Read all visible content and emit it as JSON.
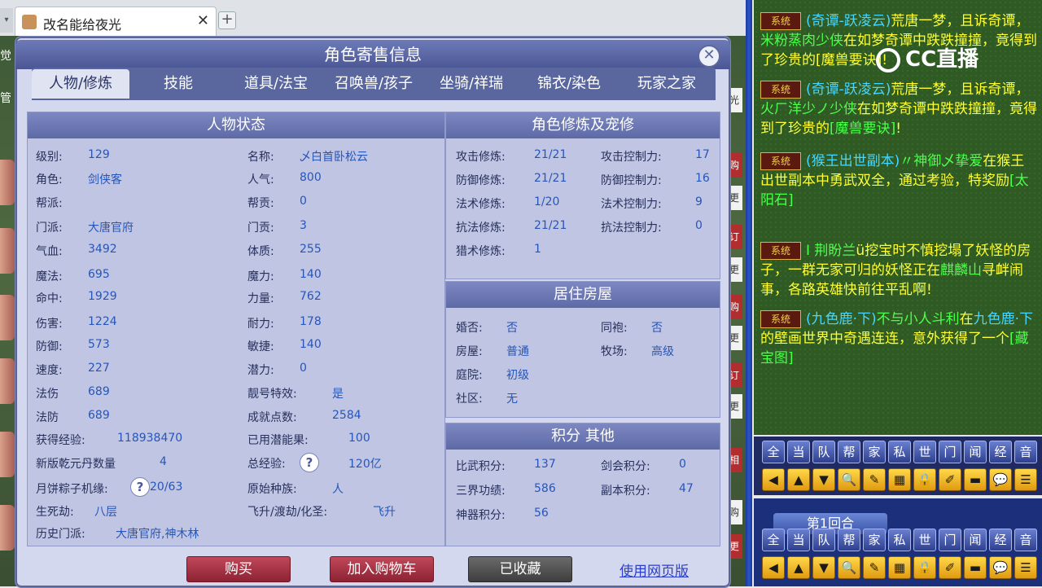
{
  "browser": {
    "tab_title": "改名能给夜光",
    "close_glyph": "✕",
    "add_glyph": "+",
    "scroll_glyph": "▾"
  },
  "left_edge_text": [
    "觉",
    "管"
  ],
  "right_strip_labels": [
    "购",
    "更",
    "订",
    "更",
    "购",
    "更",
    "订",
    "更",
    "相",
    "购",
    "更",
    "光"
  ],
  "dialog": {
    "title": "角色寄售信息",
    "close_glyph": "✕",
    "tabs": [
      "人物/修炼",
      "技能",
      "道具/法宝",
      "召唤兽/孩子",
      "坐骑/祥瑞",
      "锦衣/染色",
      "玩家之家"
    ],
    "active_tab": 0
  },
  "status": {
    "header": "人物状态",
    "left": [
      {
        "label": "级别:",
        "value": "129"
      },
      {
        "label": "角色:",
        "value": "剑侠客"
      },
      {
        "label": "帮派:",
        "value": ""
      },
      {
        "label": "门派:",
        "value": "大唐官府"
      },
      {
        "label": "气血:",
        "value": "3492"
      },
      {
        "label": "魔法:",
        "value": "695"
      },
      {
        "label": "命中:",
        "value": "1929"
      },
      {
        "label": "伤害:",
        "value": "1224"
      },
      {
        "label": "防御:",
        "value": "573"
      },
      {
        "label": "速度:",
        "value": "227"
      },
      {
        "label": "法伤",
        "value": "689"
      },
      {
        "label": "法防",
        "value": "689"
      },
      {
        "label": "获得经验:",
        "value": "118938470"
      },
      {
        "label": "新版乾元丹数量",
        "value": "4"
      },
      {
        "label": "月饼粽子机缘:",
        "value": "20/63"
      },
      {
        "label": "生死劫:",
        "value": "八层"
      },
      {
        "label": "历史门派:",
        "value": "大唐官府,神木林"
      }
    ],
    "right": [
      {
        "label": "名称:",
        "value": "乄白首卧松云"
      },
      {
        "label": "人气:",
        "value": "800"
      },
      {
        "label": "帮贡:",
        "value": "0"
      },
      {
        "label": "门贡:",
        "value": "3"
      },
      {
        "label": "体质:",
        "value": "255"
      },
      {
        "label": "魔力:",
        "value": "140"
      },
      {
        "label": "力量:",
        "value": "762"
      },
      {
        "label": "耐力:",
        "value": "178"
      },
      {
        "label": "敏捷:",
        "value": "140"
      },
      {
        "label": "潜力:",
        "value": "0"
      },
      {
        "label": "靓号特效:",
        "value": "是"
      },
      {
        "label": "成就点数:",
        "value": "2584"
      },
      {
        "label": "已用潜能果:",
        "value": "100"
      },
      {
        "label": "总经验:",
        "value": "120亿"
      },
      {
        "label": "原始种族:",
        "value": "人"
      },
      {
        "label": "飞升/渡劫/化圣:",
        "value": "飞升"
      }
    ],
    "help_glyph": "?"
  },
  "cultivation": {
    "header": "角色修炼及宠修",
    "left": [
      {
        "label": "攻击修炼:",
        "value": "21/21"
      },
      {
        "label": "防御修炼:",
        "value": "21/21"
      },
      {
        "label": "法术修炼:",
        "value": "1/20"
      },
      {
        "label": "抗法修炼:",
        "value": "21/21"
      },
      {
        "label": "猎术修炼:",
        "value": "1"
      }
    ],
    "right": [
      {
        "label": "攻击控制力:",
        "value": "17"
      },
      {
        "label": "防御控制力:",
        "value": "16"
      },
      {
        "label": "法术控制力:",
        "value": "9"
      },
      {
        "label": "抗法控制力:",
        "value": "0"
      }
    ]
  },
  "house": {
    "header": "居住房屋",
    "left": [
      {
        "label": "婚否:",
        "value": "否"
      },
      {
        "label": "房屋:",
        "value": "普通"
      },
      {
        "label": "庭院:",
        "value": "初级"
      },
      {
        "label": "社区:",
        "value": "无"
      }
    ],
    "right": [
      {
        "label": "同袍:",
        "value": "否"
      },
      {
        "label": "牧场:",
        "value": "高级"
      }
    ]
  },
  "points": {
    "header": "积分 其他",
    "left": [
      {
        "label": "比武积分:",
        "value": "137"
      },
      {
        "label": "三界功绩:",
        "value": "586"
      },
      {
        "label": "神器积分:",
        "value": "56"
      }
    ],
    "right": [
      {
        "label": "剑会积分:",
        "value": "0"
      },
      {
        "label": "副本积分:",
        "value": "47"
      }
    ]
  },
  "actions": {
    "buy": "购买",
    "add_cart": "加入购物车",
    "favorited": "已收藏",
    "web_link": "使用网页版"
  },
  "chat": {
    "logo_text": "CC直播",
    "badge": "系统",
    "messages": [
      {
        "a": "(奇谭-跃凌云)",
        "b": "荒唐一梦，且诉奇谭，",
        "c": "米粉蒸肉少侠",
        "d": "在如梦奇谭中跌跌撞撞，竟得到了珍贵的[魔兽要诀]!"
      },
      {
        "a": "(奇谭-跃凌云)",
        "b": "荒唐一梦，且诉奇谭，",
        "c": "火ㄏ洋少ノ少侠",
        "d": "在如梦奇谭中跌跌撞撞，竟得到了珍贵的",
        "e": "[魔兽要诀]",
        "f": "!"
      },
      {
        "a": "(猴王出世副本)",
        "b": "〃神御乄挚爱",
        "c": "在猴王出世副本中勇武双全，通过考验，特奖励",
        "d": "[太阳石]"
      },
      {
        "a": "I 荆盼兰",
        "b": "ü挖宝时不慎挖塌了妖怪的房子，一群无家可归的妖怪正在",
        "c": "麒麟山",
        "d": "寻衅闹事，各路英雄快前往平乱啊!"
      },
      {
        "a": "(九色鹿·下)",
        "b": "不与小人斗利",
        "c": "在",
        "d": "九色鹿·下",
        "e": "的壁画世界中奇遇连连，意外获得了一个",
        "f": "[藏宝图]"
      }
    ],
    "channel_buttons": [
      "全",
      "当",
      "队",
      "帮",
      "家",
      "私",
      "世",
      "门",
      "闻",
      "经",
      "音"
    ],
    "icon_buttons": [
      "left-arrow-icon",
      "up-arrow-icon",
      "down-arrow-icon",
      "magnifier-icon",
      "note-icon",
      "grid-icon",
      "lock-icon",
      "brush-icon",
      "folder-icon",
      "speech-icon",
      "list-icon"
    ],
    "icon_glyphs": [
      "◀",
      "▲",
      "▼",
      "🔍",
      "✎",
      "▦",
      "🔒",
      "✐",
      "▬",
      "💬",
      "☰"
    ],
    "round_label": "第1回合"
  }
}
